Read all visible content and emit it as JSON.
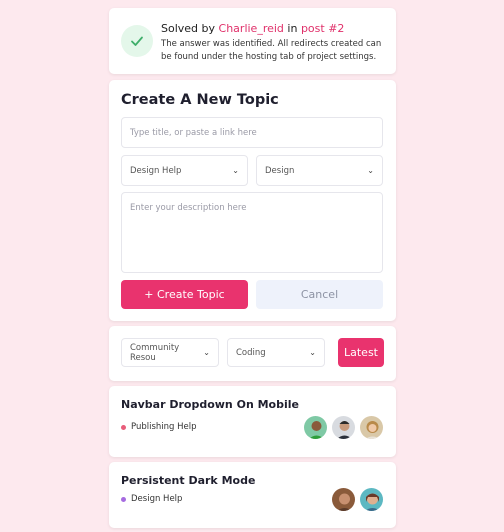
{
  "solved": {
    "prefix": "Solved by",
    "user": "Charlie_reid",
    "mid": "in",
    "post": "post #2",
    "body": "The answer was identified. All redirects created can be found under the hosting tab of project settings."
  },
  "create": {
    "title": "Create A New Topic",
    "title_placeholder": "Type title, or paste a link here",
    "category_value": "Design Help",
    "tag_value": "Design",
    "description_placeholder": "Enter your description here",
    "create_button": "+ Create Topic",
    "cancel_button": "Cancel"
  },
  "filter": {
    "category_value": "Community Resou",
    "tag_value": "Coding",
    "latest_button": "Latest"
  },
  "topics": [
    {
      "title": "Navbar Dropdown On Mobile",
      "category": "Publishing Help",
      "category_color": "#e85d7a"
    },
    {
      "title": "Persistent Dark Mode",
      "category": "Design Help",
      "category_color": "#a66be0"
    }
  ],
  "colors": {
    "accent": "#e9336e",
    "background": "#fde9ee",
    "success": "#3fae6a"
  }
}
